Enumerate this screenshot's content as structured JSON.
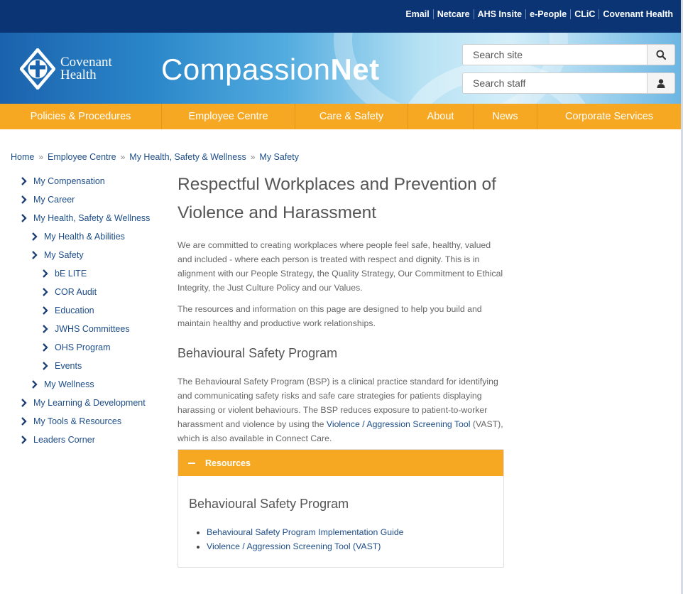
{
  "top_links": [
    "Email",
    "Netcare",
    "AHS Insite",
    "e-People",
    "CLiC",
    "Covenant Health"
  ],
  "logo": {
    "line1": "Covenant",
    "line2": "Health"
  },
  "brand": {
    "light": "Compassion",
    "bold": "Net"
  },
  "search_site": {
    "placeholder": "Search site",
    "icon": "search-icon"
  },
  "search_staff": {
    "placeholder": "Search staff",
    "icon": "person-icon"
  },
  "nav": [
    "Policies & Procedures",
    "Employee Centre",
    "Care & Safety",
    "About",
    "News",
    "Corporate Services"
  ],
  "breadcrumb": [
    "Home",
    "Employee Centre",
    "My Health, Safety & Wellness",
    "My Safety"
  ],
  "sidebar": [
    "My Compensation",
    "My Career",
    "My Health, Safety & Wellness",
    "My Health & Abilities",
    "My Safety",
    "bE LITE",
    "COR Audit",
    "Education",
    "JWHS Committees",
    "OHS Program",
    "Events",
    "My Wellness",
    "My Learning & Development",
    "My Tools & Resources",
    "Leaders Corner"
  ],
  "page": {
    "title_line1": "Respectful Workplaces and Prevention of",
    "title_line2": "Violence and Harassment",
    "intro": "We are committed to creating workplaces where people feel safe, healthy, valued and included - where each person is treated with respect and dignity. This is in alignment with our People Strategy, the Quality Strategy, Our Commitment to Ethical Integrity, the Just Culture Policy and our Values.",
    "resources_intro": "The resources and information on this page are designed to help you build and maintain healthy and productive work relationships.",
    "section_title": "Behavioural Safety Program",
    "bsp_before": "The Behavioural Safety Program (BSP) is a clinical practice standard for identifying and communicating safety risks and safe care strategies for patients displaying harassing or violent behaviours. The BSP reduces exposure to patient-to-worker harassment and violence by using the ",
    "bsp_link": "Violence / Aggression Screening Tool",
    "bsp_after": " (VAST), which is also available in Connect Care."
  },
  "panel": {
    "header": "Resources",
    "title": "Behavioural Safety Program",
    "link1": "Behavioural Safety Program Implementation Guide",
    "link2": "Violence / Aggression Screening Tool (VAST)"
  },
  "colors": {
    "navy": "#0b3474",
    "orange": "#f6a823",
    "link": "#1d4d88"
  }
}
